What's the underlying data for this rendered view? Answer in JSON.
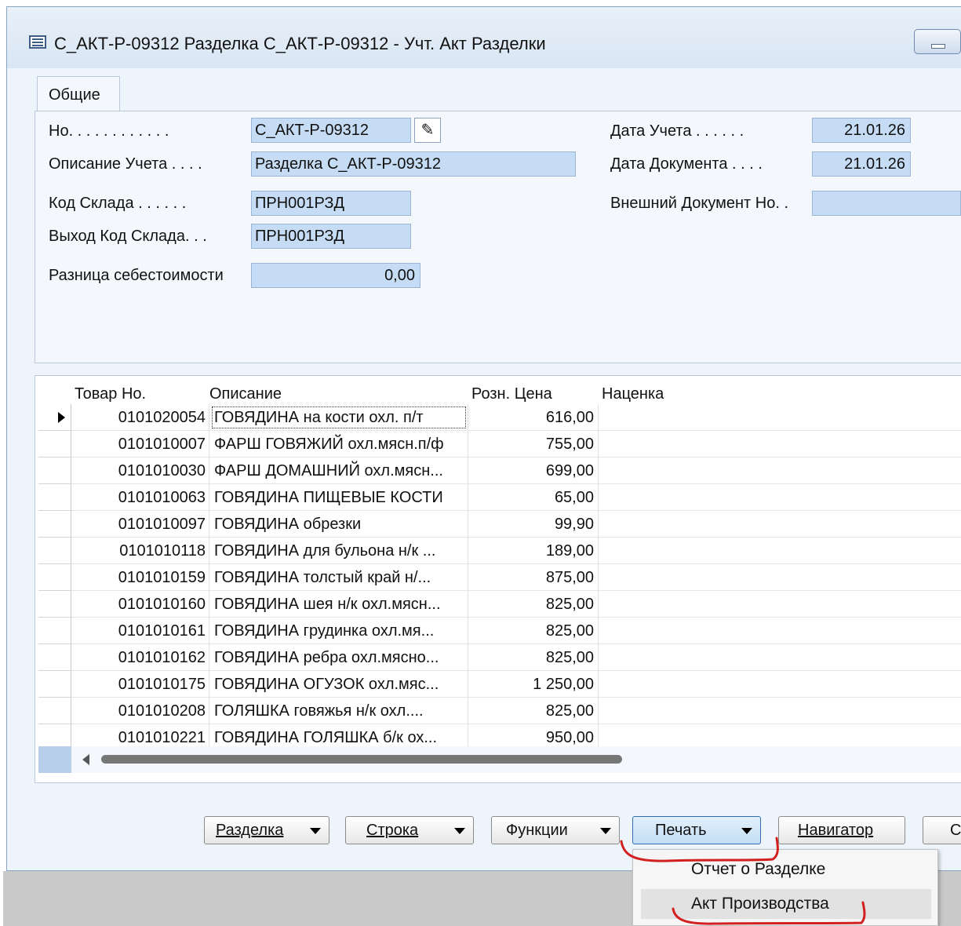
{
  "window": {
    "title": "С_АКТ-Р-09312 Разделка С_АКТ-Р-09312 - Учт. Акт Разделки"
  },
  "tabs": [
    {
      "label": "Общие"
    }
  ],
  "fields": {
    "no_label": "Но. . . . . . . . . . . .",
    "no_value": "С_АКТ-Р-09312",
    "desc_label": "Описание Учета . . . .",
    "desc_value": "Разделка С_АКТ-Р-09312",
    "wh_label": "Код Склада . . . . . .",
    "wh_value": "ПРН001РЗД",
    "out_wh_label": "Выход Код Склада. . .",
    "out_wh_value": "ПРН001РЗД",
    "cost_diff_label": "Разница себестоимости",
    "cost_diff_value": "0,00",
    "post_date_label": "Дата Учета . . . . . .",
    "post_date_value": "21.01.26",
    "doc_date_label": "Дата Документа . . . .",
    "doc_date_value": "21.01.26",
    "ext_doc_label": "Внешний Документ Но. .",
    "ext_doc_value": ""
  },
  "table": {
    "columns": [
      "Товар Но.",
      "Описание",
      "Розн. Цена",
      "Наценка"
    ],
    "rows": [
      {
        "no": "0101020054",
        "desc": "ГОВЯДИНА на кости охл. п/т",
        "price": "616,00"
      },
      {
        "no": "0101010007",
        "desc": "ФАРШ ГОВЯЖИЙ охл.мясн.п/ф",
        "price": "755,00"
      },
      {
        "no": "0101010030",
        "desc": "ФАРШ ДОМАШНИЙ охл.мясн...",
        "price": "699,00"
      },
      {
        "no": "0101010063",
        "desc": "ГОВЯДИНА ПИЩЕВЫЕ КОСТИ",
        "price": "65,00"
      },
      {
        "no": "0101010097",
        "desc": "ГОВЯДИНА обрезки",
        "price": "99,90"
      },
      {
        "no": "0101010118",
        "desc": "ГОВЯДИНА для бульона н/к ...",
        "price": "189,00"
      },
      {
        "no": "0101010159",
        "desc": "ГОВЯДИНА толстый край н/...",
        "price": "875,00"
      },
      {
        "no": "0101010160",
        "desc": "ГОВЯДИНА шея н/к охл.мясн...",
        "price": "825,00"
      },
      {
        "no": "0101010161",
        "desc": "ГОВЯДИНА грудинка охл.мя...",
        "price": "825,00"
      },
      {
        "no": "0101010162",
        "desc": "ГОВЯДИНА ребра  охл.мясно...",
        "price": "825,00"
      },
      {
        "no": "0101010175",
        "desc": "ГОВЯДИНА ОГУЗОК охл.мяс...",
        "price": "1 250,00"
      },
      {
        "no": "0101010208",
        "desc": "ГОЛЯШКА говяжья н/к охл....",
        "price": "825,00"
      },
      {
        "no": "0101010221",
        "desc": "ГОВЯДИНА ГОЛЯШКА б/к ох...",
        "price": "950,00"
      }
    ]
  },
  "buttons": {
    "razdelka": "Разделка",
    "stroka": "Строка",
    "funkcii": "Функции",
    "pechat": "Печать",
    "navigator": "Навигатор",
    "cut_off": "С"
  },
  "menu": {
    "items": [
      {
        "label": "Отчет о Разделке"
      },
      {
        "label": "Акт Производства"
      }
    ]
  },
  "colors": {
    "field_bg": "#c6dcf4",
    "annotation": "#d21f1f"
  }
}
